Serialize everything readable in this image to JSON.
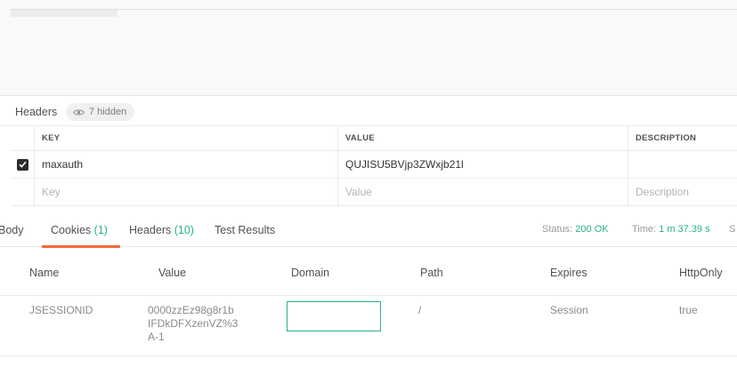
{
  "request_headers": {
    "title": "Headers",
    "hidden_label": "7 hidden",
    "columns": {
      "key": "KEY",
      "value": "VALUE",
      "description": "DESCRIPTION"
    },
    "rows": [
      {
        "checked": true,
        "key": "maxauth",
        "value": "QUJISU5BVjp3ZWxjb21l",
        "description": ""
      }
    ],
    "placeholder_row": {
      "key": "Key",
      "value": "Value",
      "description": "Description"
    }
  },
  "response_tabs": {
    "body": "Body",
    "cookies": "Cookies",
    "cookies_count": "(1)",
    "headers": "Headers",
    "headers_count": "(10)",
    "test_results": "Test Results",
    "active": "cookies"
  },
  "status": {
    "status_label": "Status:",
    "status_value": "200 OK",
    "time_label": "Time:",
    "time_value": "1 m 37.39 s",
    "size_label_partial": "S"
  },
  "cookies_table": {
    "columns": [
      "Name",
      "Value",
      "Domain",
      "Path",
      "Expires",
      "HttpOnly"
    ],
    "rows": [
      {
        "name": "JSESSIONID",
        "value_lines": [
          "0000zzEz98g8r1b",
          "IFDkDFXzenVZ%3",
          "A-1"
        ],
        "domain": "",
        "path": "/",
        "expires": "Session",
        "httponly": "true"
      }
    ]
  },
  "colors": {
    "accent_green": "#26b47f",
    "tab_underline": "#f26b3a"
  },
  "icons": {
    "hidden_headers": "eye-icon",
    "checkbox": "checkmark-icon"
  }
}
